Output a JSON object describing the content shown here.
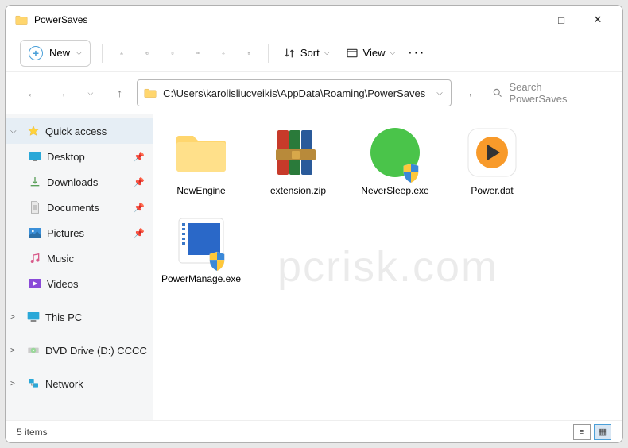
{
  "window": {
    "title": "PowerSaves"
  },
  "toolbar": {
    "new_label": "New",
    "sort_label": "Sort",
    "view_label": "View"
  },
  "address": {
    "path": "C:\\Users\\karolisliucveikis\\AppData\\Roaming\\PowerSaves"
  },
  "search": {
    "placeholder": "Search PowerSaves"
  },
  "sidebar": {
    "quick": "Quick access",
    "desktop": "Desktop",
    "downloads": "Downloads",
    "documents": "Documents",
    "pictures": "Pictures",
    "music": "Music",
    "videos": "Videos",
    "thispc": "This PC",
    "dvd": "DVD Drive (D:) CCCC",
    "network": "Network"
  },
  "items": [
    {
      "label": "NewEngine"
    },
    {
      "label": "extension.zip"
    },
    {
      "label": "NeverSleep.exe"
    },
    {
      "label": "Power.dat"
    },
    {
      "label": "PowerManage.exe"
    }
  ],
  "status": {
    "count": "5 items"
  },
  "watermark": "pcrisk.com"
}
